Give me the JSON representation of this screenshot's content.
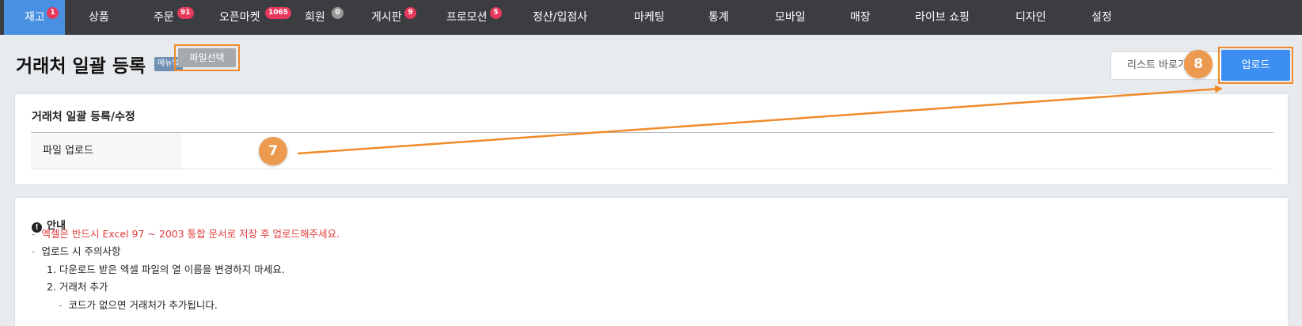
{
  "nav": {
    "items": [
      {
        "label": "재고",
        "badge": "1"
      },
      {
        "label": "상품",
        "badge": ""
      },
      {
        "label": "주문",
        "badge": "91"
      },
      {
        "label": "오픈마켓",
        "badge": "1065"
      },
      {
        "label": "회원",
        "badge": "0"
      },
      {
        "label": "게시판",
        "badge": "9"
      },
      {
        "label": "프로모션",
        "badge": "5"
      },
      {
        "label": "정산/입점사",
        "badge": ""
      },
      {
        "label": "마케팅",
        "badge": ""
      },
      {
        "label": "통계",
        "badge": ""
      },
      {
        "label": "모바일",
        "badge": ""
      },
      {
        "label": "매장",
        "badge": ""
      },
      {
        "label": "라이브 쇼핑",
        "badge": ""
      },
      {
        "label": "디자인",
        "badge": ""
      },
      {
        "label": "설정",
        "badge": ""
      }
    ]
  },
  "header": {
    "title": "거래처 일괄 등록",
    "manual": "매뉴얼",
    "list_button": "리스트 바로가기",
    "upload_button": "업로드"
  },
  "form": {
    "section_title": "거래처 일괄 등록/수정",
    "file_label": "파일 업로드",
    "file_button": "파일선택"
  },
  "guide": {
    "title": "안내",
    "line1": "엑셀은 반드시 Excel 97 ~ 2003 통합 문서로 저장 후 업로드해주세요.",
    "line2": "업로드 시 주의사항",
    "line3": "1. 다운로드 받은 엑셀 파일의 열 이름을 변경하지 마세요.",
    "line4": "2. 거래처 추가",
    "line5": "코드가 없으면 거래처가 추가됩니다."
  },
  "markers": {
    "file_step": "7",
    "upload_step": "8"
  },
  "colors": {
    "nav_bg": "#3b3d40",
    "nav_active": "#4a90e2",
    "badge": "#e8395c",
    "accent_blue": "#3c8ef0",
    "annotation_orange": "#f08a2a",
    "notice_red": "#e03b3b"
  }
}
